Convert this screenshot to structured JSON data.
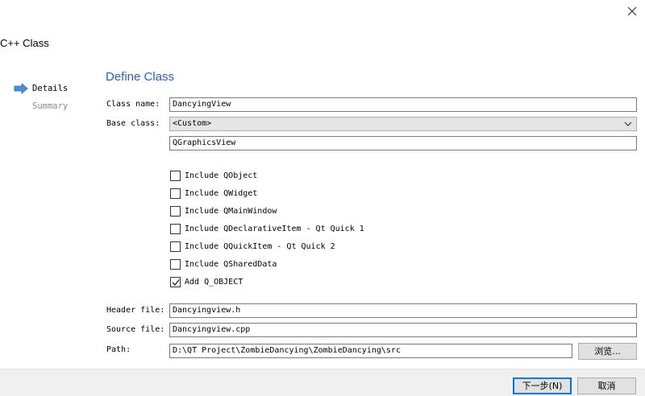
{
  "window": {
    "title": "C++ Class"
  },
  "nav": {
    "steps": [
      {
        "label": "Details",
        "active": true
      },
      {
        "label": "Summary",
        "active": false
      }
    ]
  },
  "page": {
    "heading": "Define Class"
  },
  "form": {
    "class_name_label": "Class name:",
    "class_name_value": "DancyingView",
    "base_class_label": "Base class:",
    "base_class_selected": "<Custom>",
    "custom_base_value": "QGraphicsView",
    "checkboxes": [
      {
        "label": "Include QObject",
        "checked": false
      },
      {
        "label": "Include QWidget",
        "checked": false
      },
      {
        "label": "Include QMainWindow",
        "checked": false
      },
      {
        "label": "Include QDeclarativeItem - Qt Quick 1",
        "checked": false
      },
      {
        "label": "Include QQuickItem - Qt Quick 2",
        "checked": false
      },
      {
        "label": "Include QSharedData",
        "checked": false
      },
      {
        "label": "Add Q_OBJECT",
        "checked": true
      }
    ],
    "header_file_label": "Header file:",
    "header_file_value": "Dancyingview.h",
    "source_file_label": "Source file:",
    "source_file_value": "Dancyingview.cpp",
    "path_label": "Path:",
    "path_value": "D:\\QT Project\\ZombieDancying\\ZombieDancying\\src",
    "browse_label": "浏览..."
  },
  "footer": {
    "next_label": "下一步(N)",
    "cancel_label": "取消"
  },
  "colors": {
    "heading": "#2a62a8",
    "nav_arrow": "#4a90d9",
    "default_button_border": "#0078d7"
  },
  "icons": {
    "close": "close-icon",
    "nav_arrow": "arrow-right-icon",
    "combo": "chevron-down-icon",
    "check": "check-icon"
  }
}
